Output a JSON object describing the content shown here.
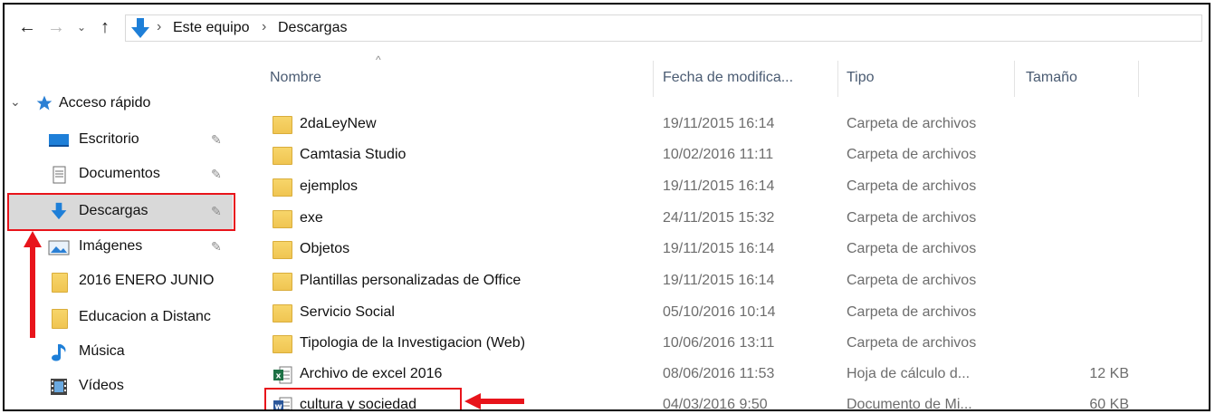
{
  "window": {
    "nav": {
      "back": "←",
      "forward": "→",
      "recent": "⌄",
      "up": "↑"
    },
    "breadcrumb": [
      "Este equipo",
      "Descargas"
    ],
    "breadcrumb_sep": "›"
  },
  "sidebar": {
    "expander": "⌄",
    "quick_access": "Acceso rápido",
    "items": [
      {
        "label": "Escritorio",
        "icon": "desktop-icon",
        "pinned": true
      },
      {
        "label": "Documentos",
        "icon": "documents-icon",
        "pinned": true
      },
      {
        "label": "Descargas",
        "icon": "downloads-icon",
        "pinned": true,
        "selected": true
      },
      {
        "label": "Imágenes",
        "icon": "pictures-icon",
        "pinned": true
      },
      {
        "label": "2016 ENERO JUNIO",
        "icon": "folder-icon",
        "pinned": false
      },
      {
        "label": "Educacion a Distanc",
        "icon": "folder-icon",
        "pinned": false
      },
      {
        "label": "Música",
        "icon": "music-icon",
        "pinned": false
      },
      {
        "label": "Vídeos",
        "icon": "videos-icon",
        "pinned": false
      }
    ],
    "pin_glyph": "📌"
  },
  "columns": {
    "name": "Nombre",
    "date": "Fecha de modifica...",
    "type": "Tipo",
    "size": "Tamaño",
    "sort_glyph": "^"
  },
  "files": [
    {
      "name": "2daLeyNew",
      "date": "19/11/2015 16:14",
      "type": "Carpeta de archivos",
      "size": "",
      "icon": "folder-icon"
    },
    {
      "name": "Camtasia Studio",
      "date": "10/02/2016 11:11",
      "type": "Carpeta de archivos",
      "size": "",
      "icon": "folder-icon"
    },
    {
      "name": "ejemplos",
      "date": "19/11/2015 16:14",
      "type": "Carpeta de archivos",
      "size": "",
      "icon": "folder-icon"
    },
    {
      "name": "exe",
      "date": "24/11/2015 15:32",
      "type": "Carpeta de archivos",
      "size": "",
      "icon": "folder-icon"
    },
    {
      "name": "Objetos",
      "date": "19/11/2015 16:14",
      "type": "Carpeta de archivos",
      "size": "",
      "icon": "folder-icon"
    },
    {
      "name": "Plantillas personalizadas de Office",
      "date": "19/11/2015 16:14",
      "type": "Carpeta de archivos",
      "size": "",
      "icon": "folder-icon"
    },
    {
      "name": "Servicio Social",
      "date": "05/10/2016 10:14",
      "type": "Carpeta de archivos",
      "size": "",
      "icon": "folder-icon"
    },
    {
      "name": "Tipologia de la Investigacion (Web)",
      "date": "10/06/2016 13:11",
      "type": "Carpeta de archivos",
      "size": "",
      "icon": "folder-icon"
    },
    {
      "name": "Archivo de excel 2016",
      "date": "08/06/2016 11:53",
      "type": "Hoja de cálculo d...",
      "size": "12 KB",
      "icon": "excel-file-icon"
    },
    {
      "name": "cultura y sociedad",
      "date": "04/03/2016 9:50",
      "type": "Documento de Mi...",
      "size": "60 KB",
      "icon": "word-file-icon"
    }
  ],
  "colors": {
    "highlight": "#e8141b",
    "selected_bg": "#d9d9d9",
    "download_blue": "#1e7fd8",
    "folder_yellow": "#f3cb5a"
  }
}
